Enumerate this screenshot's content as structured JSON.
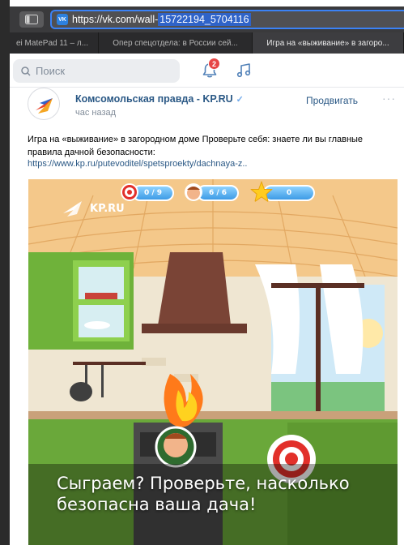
{
  "browser": {
    "url_prefix": "https://vk.com/wall-",
    "url_selected": "15722194_5704116",
    "tabs": [
      {
        "label": "ei MatePad 11 – л..."
      },
      {
        "label": "Опер спецотдела: в России сей..."
      },
      {
        "label": "Игра на «выживание» в загоро..."
      }
    ]
  },
  "vk_header": {
    "search_placeholder": "Поиск",
    "notifications_count": "2"
  },
  "post": {
    "author": "Комсомольская правда - KP.RU",
    "verified_mark": "✓",
    "time": "час назад",
    "promote_label": "Продвигать",
    "more_label": "···",
    "text": "Игра на «выживание» в загородном доме Проверьте себя: знаете ли вы главные правила дачной безопасности:",
    "link": "https://www.kp.ru/putevoditel/spetsproekty/dachnaya-z..",
    "image": {
      "hud_targets": "0 / 9",
      "hud_people": "6 / 6",
      "hud_stars": "0",
      "logo_text": "KP.RU",
      "caption_line1": "Сыграем? Проверьте, насколько",
      "caption_line2": "безопасна ваша дача!"
    }
  },
  "colors": {
    "vk_link": "#2a5885",
    "badge_red": "#e64646",
    "url_border": "#3b82f6"
  }
}
